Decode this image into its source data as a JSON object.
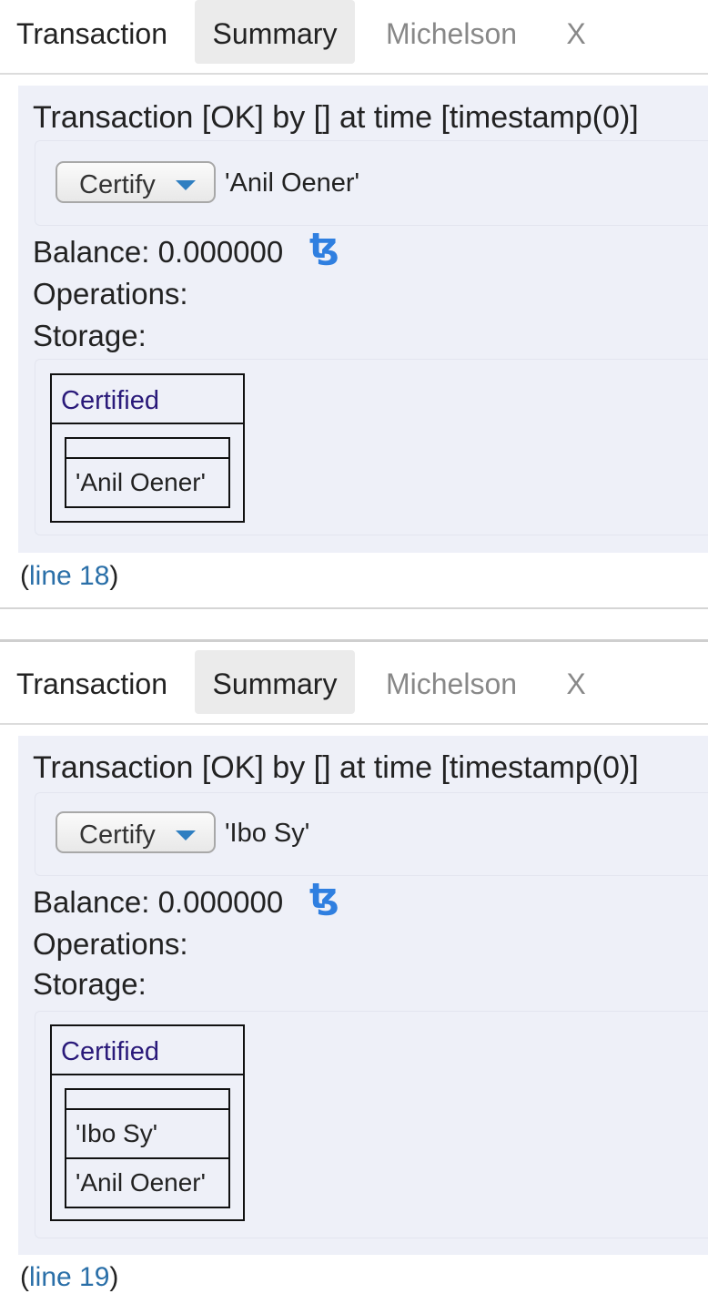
{
  "blocks": [
    {
      "tabs": [
        "Transaction",
        "Summary",
        "Michelson",
        "X"
      ],
      "active_tab": "Summary",
      "title": "Transaction [OK] by [] at time [timestamp(0)]",
      "entrypoint": "Certify",
      "param": "'Anil Oener'",
      "balance_label": "Balance: 0.000000",
      "tez_symbol": "ꜩ",
      "operations_label": "Operations:",
      "storage_label": "Storage:",
      "record_field": "Certified",
      "certified": [
        "'Anil Oener'"
      ],
      "line_open": "(",
      "line_link": "line 18",
      "line_close": ")"
    },
    {
      "tabs": [
        "Transaction",
        "Summary",
        "Michelson",
        "X"
      ],
      "active_tab": "Summary",
      "title": "Transaction [OK] by [] at time [timestamp(0)]",
      "entrypoint": "Certify",
      "param": "'Ibo Sy'",
      "balance_label": "Balance: 0.000000",
      "tez_symbol": "ꜩ",
      "operations_label": "Operations:",
      "storage_label": "Storage:",
      "record_field": "Certified",
      "certified": [
        "'Ibo Sy'",
        "'Anil Oener'"
      ],
      "line_open": "(",
      "line_link": "line 19",
      "line_close": ")"
    }
  ]
}
